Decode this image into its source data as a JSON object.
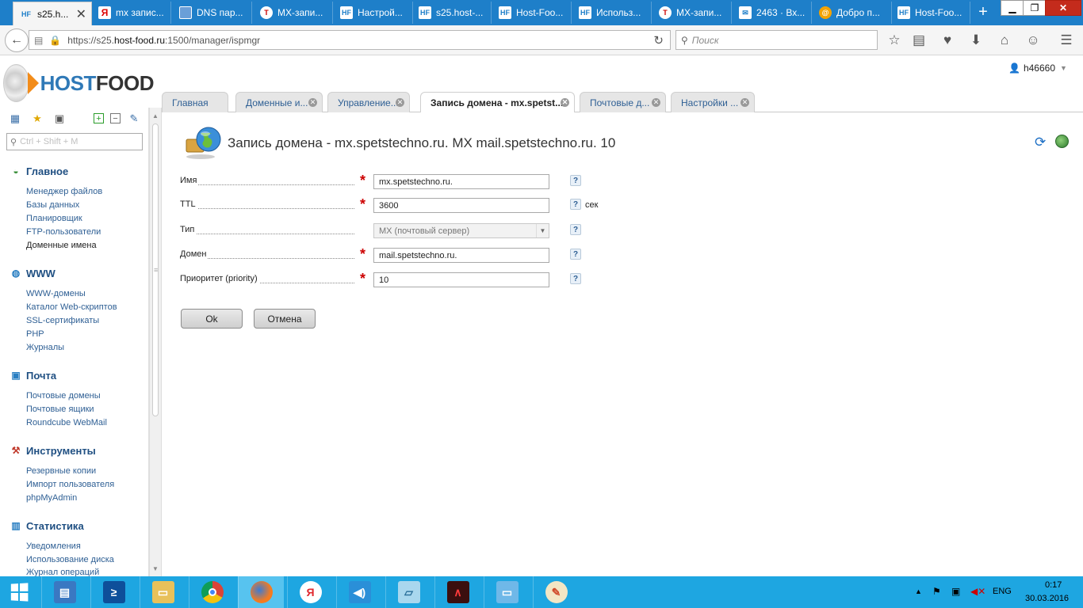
{
  "browser": {
    "tabs": [
      {
        "label": "s25.h...",
        "icon": "hf",
        "active": true
      },
      {
        "label": "mx запис...",
        "icon": "yandex"
      },
      {
        "label": "DNS пар...",
        "icon": "dns"
      },
      {
        "label": "МХ-запи...",
        "icon": "mx"
      },
      {
        "label": "Настрой...",
        "icon": "hf"
      },
      {
        "label": "s25.host-...",
        "icon": "hf"
      },
      {
        "label": "Host-Foo...",
        "icon": "hf"
      },
      {
        "label": "Использ...",
        "icon": "hf"
      },
      {
        "label": "МХ-запи...",
        "icon": "mx"
      },
      {
        "label": "2463 · Вх...",
        "icon": "mail"
      },
      {
        "label": "Добро п...",
        "icon": "ok"
      },
      {
        "label": "Host-Foo...",
        "icon": "hf"
      }
    ],
    "new_tab": "+",
    "url_prefix": "https://s25.",
    "url_host": "host-food.ru",
    "url_rest": ":1500/manager/ispmgr",
    "search_placeholder": "Поиск"
  },
  "header": {
    "logo_host": "HOST",
    "logo_food": "FOOD",
    "username": "h46660"
  },
  "app_tabs": [
    {
      "label": "Главная",
      "closable": false
    },
    {
      "label": "Доменные и...",
      "closable": true
    },
    {
      "label": "Управление...",
      "closable": true
    },
    {
      "label": "Запись домена - mx.spetst...",
      "closable": true,
      "active": true
    },
    {
      "label": "Почтовые д...",
      "closable": true
    },
    {
      "label": "Настройки ...",
      "closable": true
    }
  ],
  "sidebar": {
    "search_placeholder": "Ctrl + Shift + M",
    "sections": [
      {
        "title": "Главное",
        "items": [
          "Менеджер файлов",
          "Базы данных",
          "Планировщик",
          "FTP-пользователи",
          "Доменные имена"
        ]
      },
      {
        "title": "WWW",
        "items": [
          "WWW-домены",
          "Каталог Web-скриптов",
          "SSL-сертификаты",
          "PHP",
          "Журналы"
        ]
      },
      {
        "title": "Почта",
        "items": [
          "Почтовые домены",
          "Почтовые ящики",
          "Roundcube WebMail"
        ]
      },
      {
        "title": "Инструменты",
        "items": [
          "Резервные копии",
          "Импорт пользователя",
          "phpMyAdmin"
        ]
      },
      {
        "title": "Статистика",
        "items": [
          "Уведомления",
          "Использование диска",
          "Журнал операций"
        ]
      }
    ],
    "current_item": "Доменные имена"
  },
  "form": {
    "title": "Запись домена - mx.spetstechno.ru. MX mail.spetstechno.ru. 10",
    "fields": {
      "name": {
        "label": "Имя",
        "value": "mx.spetstechno.ru."
      },
      "ttl": {
        "label": "TTL",
        "value": "3600",
        "unit": "сек"
      },
      "type": {
        "label": "Тип",
        "value": "MX (почтовый сервер)"
      },
      "domain": {
        "label": "Домен",
        "value": "mail.spetstechno.ru."
      },
      "priority": {
        "label": "Приоритет (priority)",
        "value": "10"
      }
    },
    "help_glyph": "?",
    "ok_label": "Ok",
    "cancel_label": "Отмена"
  },
  "taskbar": {
    "lang": "ENG",
    "time": "0:17",
    "date": "30.03.2016"
  },
  "colors": {
    "browser_chrome": "#1e7fc9",
    "taskbar": "#1ea6e1",
    "link": "#2e5f94",
    "required": "#cc0000"
  }
}
